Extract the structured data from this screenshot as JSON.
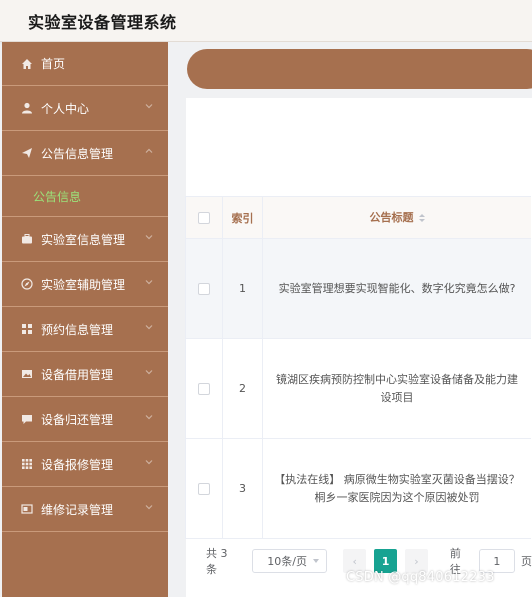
{
  "app": {
    "title": "实验室设备管理系统"
  },
  "sidebar": {
    "items": [
      {
        "label": "首页",
        "icon": "home-icon"
      },
      {
        "label": "个人中心",
        "icon": "user-icon"
      },
      {
        "label": "公告信息管理",
        "icon": "send-icon"
      },
      {
        "label": "公告信息",
        "sub": true
      },
      {
        "label": "实验室信息管理",
        "icon": "briefcase-icon"
      },
      {
        "label": "实验室辅助管理",
        "icon": "compass-icon"
      },
      {
        "label": "预约信息管理",
        "icon": "grid-icon"
      },
      {
        "label": "设备借用管理",
        "icon": "picture-icon"
      },
      {
        "label": "设备归还管理",
        "icon": "message-icon"
      },
      {
        "label": "设备报修管理",
        "icon": "apps-icon"
      },
      {
        "label": "维修记录管理",
        "icon": "window-icon"
      }
    ],
    "active_sub_color": "#9be37a",
    "bg_color": "#a6704f"
  },
  "table": {
    "headers": {
      "index": "索引",
      "title": "公告标题"
    },
    "rows": [
      {
        "index": "1",
        "title": "实验室管理想要实现智能化、数字化究竟怎么做?"
      },
      {
        "index": "2",
        "title": "镜湖区疾病预防控制中心实验室设备储备及能力建设项目"
      },
      {
        "index": "3",
        "title": "【执法在线】 病原微生物实验室灭菌设备当摆设？桐乡一家医院因为这个原因被处罚"
      }
    ]
  },
  "pagination": {
    "total": "共 3 条",
    "page_size": "10条/页",
    "prev": "‹",
    "current": "1",
    "next": "›",
    "goto": "前往",
    "goto_value": "1",
    "page_unit": "页",
    "accent_color": "#17a392"
  },
  "watermark": "CSDN @qq840612233"
}
